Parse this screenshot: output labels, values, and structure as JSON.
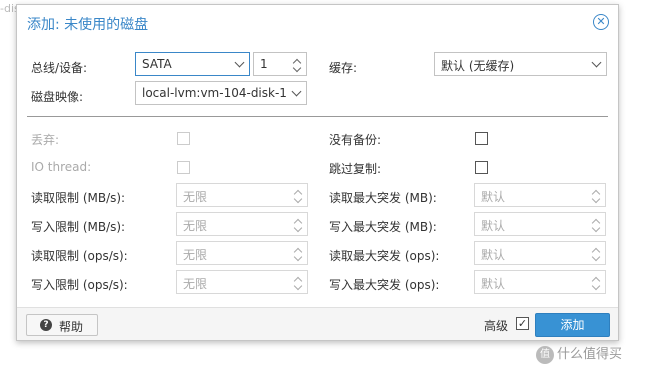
{
  "background": {
    "text": "-dis"
  },
  "dialog": {
    "title": "添加: 未使用的磁盘"
  },
  "form": {
    "bus_device": {
      "label": "总线/设备:",
      "bus_value": "SATA",
      "device_value": "1"
    },
    "cache": {
      "label": "缓存:",
      "value": "默认 (无缓存)"
    },
    "disk_image": {
      "label": "磁盘映像:",
      "value": "local-lvm:vm-104-disk-1"
    },
    "discard": {
      "label": "丢弃:",
      "checked": false,
      "disabled": true
    },
    "no_backup": {
      "label": "没有备份:",
      "checked": false
    },
    "io_thread": {
      "label": "IO thread:",
      "checked": false,
      "disabled": true
    },
    "skip_replication": {
      "label": "跳过复制:",
      "checked": false
    },
    "read_limit_mb": {
      "label": "读取限制 (MB/s):",
      "placeholder": "无限"
    },
    "write_limit_mb": {
      "label": "写入限制 (MB/s):",
      "placeholder": "无限"
    },
    "read_limit_ops": {
      "label": "读取限制 (ops/s):",
      "placeholder": "无限"
    },
    "write_limit_ops": {
      "label": "写入限制 (ops/s):",
      "placeholder": "无限"
    },
    "read_burst_mb": {
      "label": "读取最大突发 (MB):",
      "placeholder": "默认"
    },
    "write_burst_mb": {
      "label": "写入最大突发 (MB):",
      "placeholder": "默认"
    },
    "read_burst_ops": {
      "label": "读取最大突发 (ops):",
      "placeholder": "默认"
    },
    "write_burst_ops": {
      "label": "写入最大突发 (ops):",
      "placeholder": "默认"
    }
  },
  "footer": {
    "help_label": "帮助",
    "advanced_label": "高级",
    "advanced_checked": true,
    "add_label": "添加"
  },
  "watermark": {
    "text": "什么值得买"
  },
  "colors": {
    "accent": "#3a87c8",
    "button": "#3892d4"
  }
}
